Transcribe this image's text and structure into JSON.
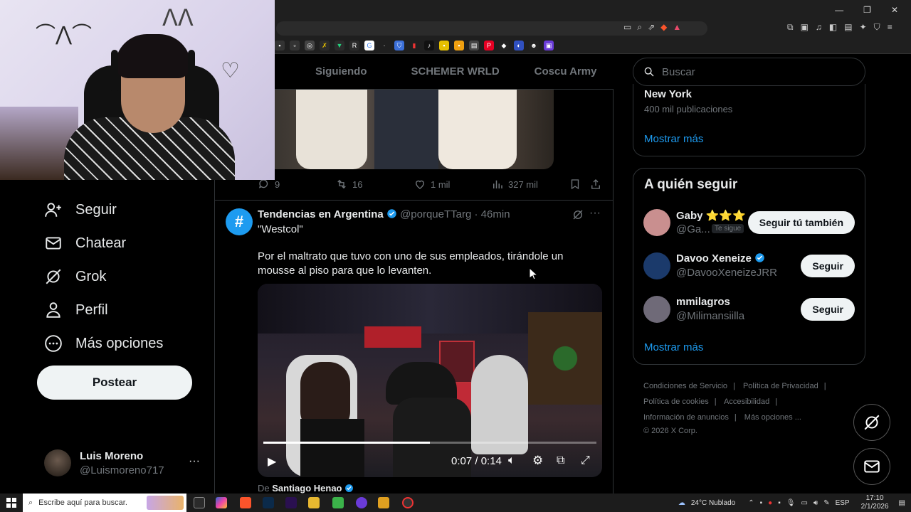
{
  "feed_tabs": [
    "Siguiendo",
    "SCHEMER WRLD",
    "Coscu Army"
  ],
  "nav": {
    "items": [
      {
        "label": "Seguir",
        "icon": "person-plus-icon"
      },
      {
        "label": "Chatear",
        "icon": "mail-icon"
      },
      {
        "label": "Grok",
        "icon": "grok-icon"
      },
      {
        "label": "Perfil",
        "icon": "person-icon"
      },
      {
        "label": "Más opciones",
        "icon": "more-circle-icon"
      }
    ],
    "post_button": "Postear"
  },
  "profile": {
    "name": "Luis Moreno",
    "handle": "@Luismoreno717",
    "more": "···"
  },
  "post1_actions": {
    "replies": "9",
    "reposts": "16",
    "likes": "1 mil",
    "views": "327 mil"
  },
  "tweet": {
    "author": "Tendencias en Argentina",
    "handle": "@porqueTTarg",
    "time": "· 46min",
    "quote": "\"Westcol\"",
    "text": "Por el maltrato que tuvo con uno de sus empleados, tirándole un mousse al piso para que lo levanten.",
    "video_time": "0:07 / 0:14",
    "video_progress": 0.5,
    "from_prefix": "De",
    "from_name": "Santiago Henao"
  },
  "search": {
    "placeholder": "Buscar"
  },
  "trend": {
    "name": "New York",
    "posts": "400 mil publicaciones",
    "show_more": "Mostrar más"
  },
  "who_to_follow": {
    "title": "A quién seguir",
    "users": [
      {
        "name": "Gaby ⭐⭐⭐",
        "handle": "@Ga...",
        "badge": "Te sigue",
        "button": "Seguir tú también",
        "color": "#c98f8f"
      },
      {
        "name": "Davoo Xeneize",
        "handle": "@DavooXeneizeJRR",
        "verified": true,
        "button": "Seguir",
        "color": "#1b3a6b"
      },
      {
        "name": "mmilagros",
        "handle": "@Milimansiilla",
        "button": "Seguir",
        "color": "#6f6a78"
      }
    ],
    "show_more": "Mostrar más"
  },
  "footer": {
    "links": [
      "Condiciones de Servicio",
      "Política de Privacidad",
      "Política de cookies",
      "Accesibilidad",
      "Información de anuncios",
      "Más opciones ..."
    ],
    "copyright": "© 2026 X Corp."
  },
  "taskbar": {
    "search_placeholder": "Escribe aquí para buscar.",
    "weather": "24°C  Nublado",
    "lang": "ESP",
    "time": "17:10",
    "date": "2/1/2026"
  },
  "colors": {
    "accent": "#1d9bf0",
    "bg": "#000000",
    "border": "#2f3336",
    "muted": "#71767b"
  }
}
